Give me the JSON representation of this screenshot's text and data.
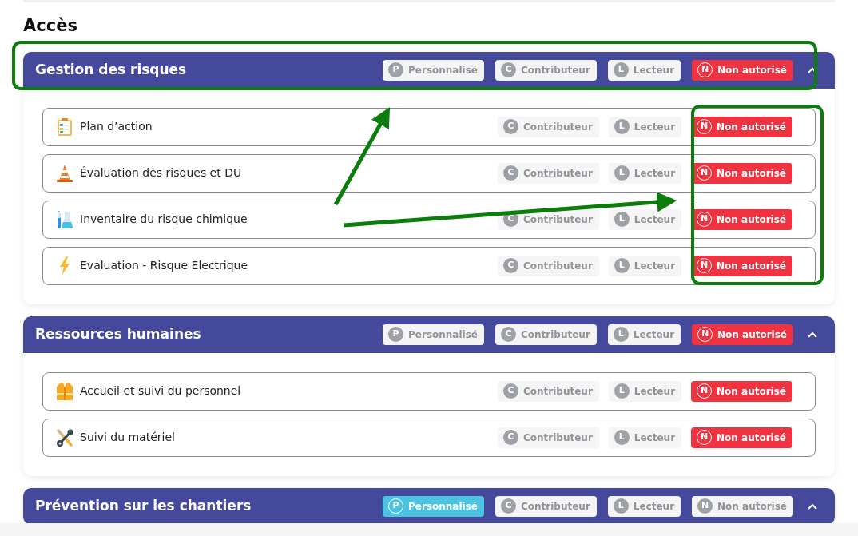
{
  "page_title": "Accès",
  "sections": [
    {
      "title": "Gestion des risques",
      "expanded": true,
      "badges": [
        {
          "kind": "personalise",
          "letter": "P",
          "label": "Personnalisé",
          "selected": false
        },
        {
          "kind": "contributeur",
          "letter": "C",
          "label": "Contributeur",
          "selected": false
        },
        {
          "kind": "lecteur",
          "letter": "L",
          "label": "Lecteur",
          "selected": false
        },
        {
          "kind": "non_autorise",
          "letter": "N",
          "label": "Non autorisé",
          "selected": true
        }
      ],
      "items": [
        {
          "label": "Plan d’action",
          "kind": "clipboard",
          "badges": [
            {
              "kind": "contributeur",
              "letter": "C",
              "label": "Contributeur",
              "selected": false
            },
            {
              "kind": "lecteur",
              "letter": "L",
              "label": "Lecteur",
              "selected": false
            },
            {
              "kind": "non_autorise",
              "letter": "N",
              "label": "Non autorisé",
              "selected": true
            }
          ]
        },
        {
          "label": "Évaluation des risques et DU",
          "kind": "cone",
          "badges": [
            {
              "kind": "contributeur",
              "letter": "C",
              "label": "Contributeur",
              "selected": false
            },
            {
              "kind": "lecteur",
              "letter": "L",
              "label": "Lecteur",
              "selected": false
            },
            {
              "kind": "non_autorise",
              "letter": "N",
              "label": "Non autorisé",
              "selected": true
            }
          ]
        },
        {
          "label": "Inventaire du risque chimique",
          "kind": "flask",
          "badges": [
            {
              "kind": "contributeur",
              "letter": "C",
              "label": "Contributeur",
              "selected": false
            },
            {
              "kind": "lecteur",
              "letter": "L",
              "label": "Lecteur",
              "selected": false
            },
            {
              "kind": "non_autorise",
              "letter": "N",
              "label": "Non autorisé",
              "selected": true
            }
          ]
        },
        {
          "label": "Evaluation - Risque Electrique",
          "kind": "bolt",
          "badges": [
            {
              "kind": "contributeur",
              "letter": "C",
              "label": "Contributeur",
              "selected": false
            },
            {
              "kind": "lecteur",
              "letter": "L",
              "label": "Lecteur",
              "selected": false
            },
            {
              "kind": "non_autorise",
              "letter": "N",
              "label": "Non autorisé",
              "selected": true
            }
          ]
        }
      ]
    },
    {
      "title": "Ressources humaines",
      "expanded": true,
      "badges": [
        {
          "kind": "personalise",
          "letter": "P",
          "label": "Personnalisé",
          "selected": false
        },
        {
          "kind": "contributeur",
          "letter": "C",
          "label": "Contributeur",
          "selected": false
        },
        {
          "kind": "lecteur",
          "letter": "L",
          "label": "Lecteur",
          "selected": false
        },
        {
          "kind": "non_autorise",
          "letter": "N",
          "label": "Non autorisé",
          "selected": true
        }
      ],
      "items": [
        {
          "label": "Accueil et suivi du personnel",
          "kind": "vest",
          "badges": [
            {
              "kind": "contributeur",
              "letter": "C",
              "label": "Contributeur",
              "selected": false
            },
            {
              "kind": "lecteur",
              "letter": "L",
              "label": "Lecteur",
              "selected": false
            },
            {
              "kind": "non_autorise",
              "letter": "N",
              "label": "Non autorisé",
              "selected": true
            }
          ]
        },
        {
          "label": "Suivi du matériel",
          "kind": "tools",
          "badges": [
            {
              "kind": "contributeur",
              "letter": "C",
              "label": "Contributeur",
              "selected": false
            },
            {
              "kind": "lecteur",
              "letter": "L",
              "label": "Lecteur",
              "selected": false
            },
            {
              "kind": "non_autorise",
              "letter": "N",
              "label": "Non autorisé",
              "selected": true
            }
          ]
        }
      ]
    },
    {
      "title": "Prévention sur les chantiers",
      "expanded": true,
      "badges": [
        {
          "kind": "personalise",
          "letter": "P",
          "label": "Personnalisé",
          "selected": true
        },
        {
          "kind": "contributeur",
          "letter": "C",
          "label": "Contributeur",
          "selected": false
        },
        {
          "kind": "lecteur",
          "letter": "L",
          "label": "Lecteur",
          "selected": false
        },
        {
          "kind": "non_autorise",
          "letter": "N",
          "label": "Non autorisé",
          "selected": false
        }
      ]
    }
  ]
}
